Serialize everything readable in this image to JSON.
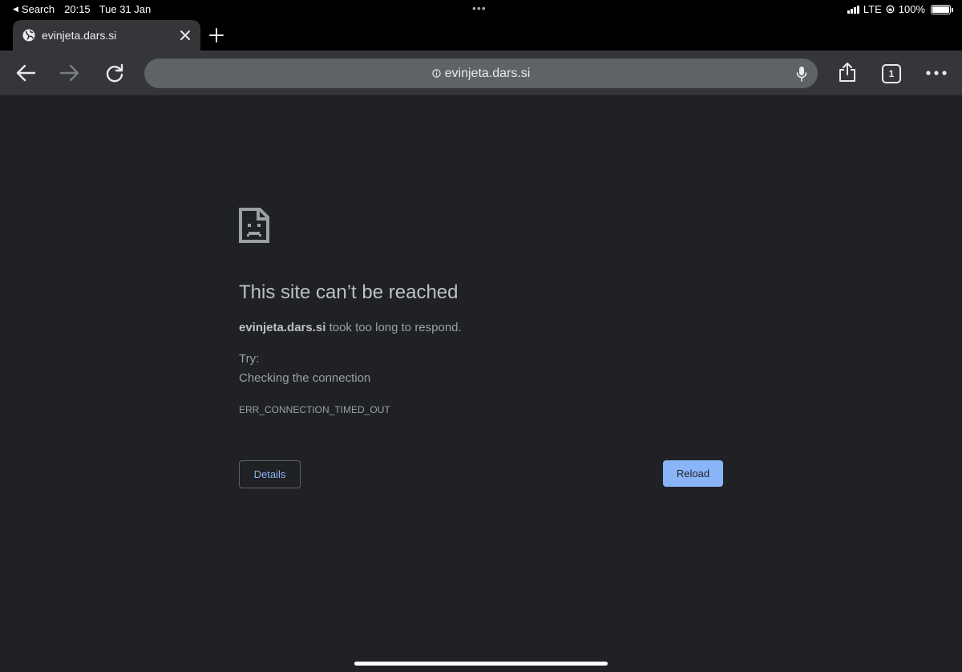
{
  "status_bar": {
    "back_app": "Search",
    "time": "20:15",
    "date": "Tue 31 Jan",
    "network": "LTE",
    "battery": "100%"
  },
  "tab": {
    "title": "evinjeta.dars.si"
  },
  "omnibox": {
    "url": "evinjeta.dars.si"
  },
  "toolbar": {
    "tab_count": "1"
  },
  "error": {
    "title": "This site can’t be reached",
    "host": "evinjeta.dars.si",
    "message": " took too long to respond.",
    "try_label": "Try:",
    "suggestion": "Checking the connection",
    "code": "ERR_CONNECTION_TIMED_OUT",
    "details_label": "Details",
    "reload_label": "Reload"
  },
  "colors": {
    "page_background": "#202124",
    "toolbar_background": "#35363a",
    "omnibox_background": "#5f6368",
    "accent": "#8ab4f8"
  }
}
